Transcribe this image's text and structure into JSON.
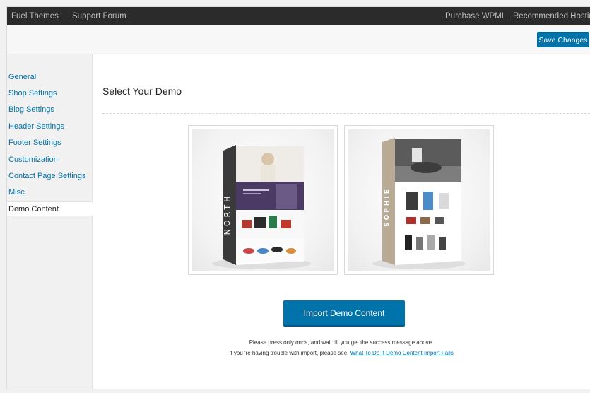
{
  "topbar": {
    "links": [
      "Fuel Themes",
      "Support Forum",
      "Purchase WPML",
      "Recommended Hosting"
    ]
  },
  "toolbar": {
    "save_label": "Save Changes"
  },
  "sidebar": {
    "items": [
      {
        "label": "General"
      },
      {
        "label": "Shop Settings"
      },
      {
        "label": "Blog Settings"
      },
      {
        "label": "Header Settings"
      },
      {
        "label": "Footer Settings"
      },
      {
        "label": "Customization"
      },
      {
        "label": "Contact Page Settings"
      },
      {
        "label": "Misc"
      },
      {
        "label": "Demo Content",
        "active": true
      }
    ]
  },
  "main": {
    "title": "Select Your Demo",
    "demos": [
      {
        "name": "NORTH",
        "spine_color": "#3a3a3a"
      },
      {
        "name": "SOPHIE",
        "spine_color": "#b9aa96"
      }
    ],
    "import_label": "Import Demo Content",
    "note_line1": "Please press only once, and wait till you get the success message above.",
    "note_line2_prefix": "If you 're having trouble with import, please see:",
    "note_link": "What To Do If Demo Content Import Fails"
  },
  "colors": {
    "accent": "#0073aa",
    "topbar_bg": "#2b2b2b"
  }
}
